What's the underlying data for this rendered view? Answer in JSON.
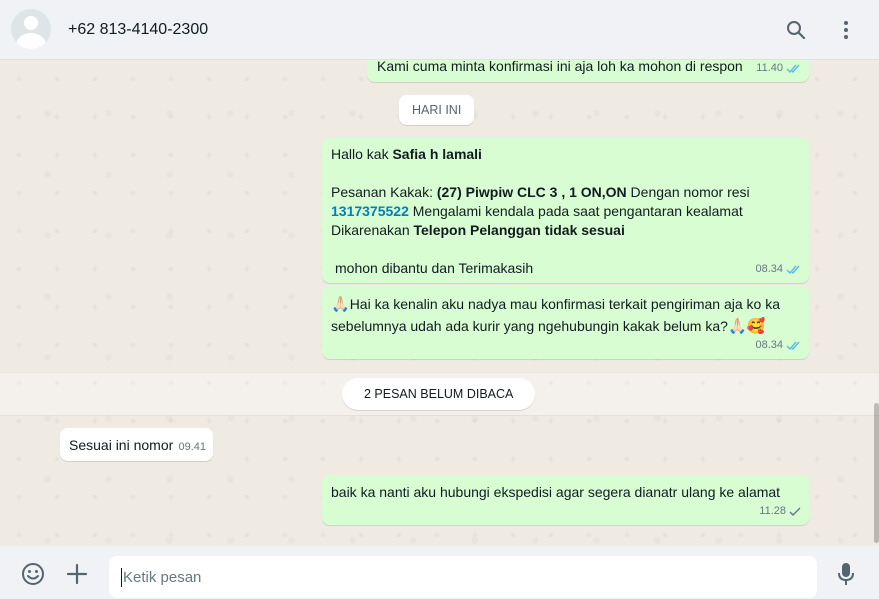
{
  "header": {
    "contact_name": "+62 813-4140-2300",
    "icons": [
      "search-icon",
      "menu-dots-icon"
    ]
  },
  "chat": {
    "top_message": {
      "text": "Kami cuma minta konfirmasi ini aja loh ka mohon di respon",
      "time": "11.40",
      "status": "read"
    },
    "date_divider": "HARI INI",
    "message1": {
      "greeting_prefix": "Hallo kak ",
      "customer_name": "Safia h lamali",
      "order_prefix": "Pesanan Kakak: ",
      "order_item": "(27) Piwpiw CLC 3 , 1 ON,ON",
      "order_mid": " Dengan nomor resi",
      "tracking_number": "1317375522",
      "delivery_issue": " Mengalami kendala pada saat pengantaran kealamat",
      "reason_prefix": "Dikarenakan ",
      "reason": "Telepon Pelanggan tidak sesuai",
      "closing": "mohon dibantu dan Terimakasih",
      "time": "08.34",
      "status": "read"
    },
    "message2": {
      "emoji_start": "🙏🏻",
      "line1": "Hai ka kenalin aku nadya mau konfirmasi terkait pengiriman aja ko ka",
      "line2": "sebelumnya udah ada kurir yang ngehubungin kakak belum ka?",
      "emoji_end": "🙏🏻🥰",
      "time": "08.34",
      "status": "read"
    },
    "unread_divider": "2 PESAN BELUM DIBACA",
    "incoming": {
      "text": "Sesuai ini nomor",
      "time": "09.41"
    },
    "last_message": {
      "text": "baik ka nanti aku hubungi ekspedisi agar segera dianatr ulang ke alamat",
      "time": "11.28",
      "status": "sent"
    }
  },
  "composer": {
    "placeholder": "Ketik pesan",
    "value": "",
    "icons": [
      "emoji-icon",
      "attach-plus-icon",
      "microphone-icon"
    ]
  },
  "colors": {
    "outgoing_bubble": "#d9fdd3",
    "incoming_bubble": "#ffffff",
    "read_tick": "#53bdeb",
    "sent_tick": "#667781",
    "link": "#027eb5"
  }
}
